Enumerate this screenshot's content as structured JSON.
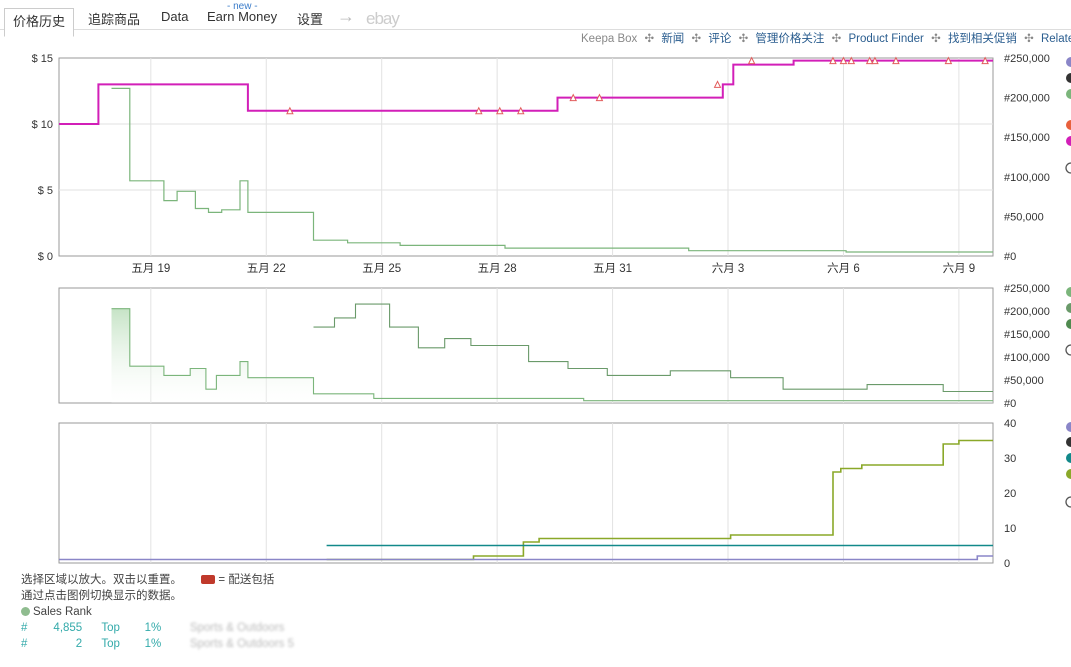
{
  "tabs": {
    "price_history": "价格历史",
    "tracking": "追踪商品",
    "data": "Data",
    "earn": "Earn Money",
    "earn_badge": "- new -",
    "settings": "设置",
    "arrow": "→",
    "ebay": "ebay"
  },
  "links": {
    "keepa_box": "Keepa Box",
    "news": "新闻",
    "reviews": "评论",
    "manage": "管理价格关注",
    "finder": "Product Finder",
    "deals": "找到相关促销",
    "related": "Relate",
    "sep": "✣"
  },
  "colors": {
    "price_line": "#d21fb8",
    "rank_green": "#7bb57b",
    "offer_olive": "#8aa829",
    "offer_teal": "#12898a",
    "offer_purple": "#8a86c8",
    "grid": "#e2e2e2"
  },
  "chart_data": [
    {
      "type": "line",
      "name": "price",
      "x_tick_labels": [
        "五月 19",
        "五月 22",
        "五月 25",
        "五月 28",
        "五月 31",
        "六月 3",
        "六月 6",
        "六月 9"
      ],
      "y_left_ticks": [
        "$ 0",
        "$ 5",
        "$ 10",
        "$ 15"
      ],
      "y_right_ticks": [
        "#0",
        "#50,000",
        "#100,000",
        "#150,000",
        "#200,000",
        "#250,000"
      ],
      "ylim": [
        0,
        15
      ],
      "grid": true,
      "series": [
        {
          "color": "#d21fb8",
          "x": [
            0,
            1.5,
            1.5,
            7.2,
            7.2,
            19,
            19,
            25.3,
            25.3,
            25.7,
            25.7,
            28,
            28,
            35.6
          ],
          "y": [
            10,
            10,
            13,
            13,
            11,
            11,
            12,
            12,
            13,
            13,
            14.5,
            14.5,
            14.8,
            14.8
          ]
        },
        {
          "color": "#7bb57b",
          "x": [
            2,
            2.7,
            2.7,
            4,
            4,
            4.5,
            4.5,
            5.2,
            5.2,
            5.7,
            5.7,
            6.2,
            6.2,
            6.9,
            6.9,
            7.2,
            7.2,
            9.7,
            9.7,
            11,
            11,
            13,
            13,
            17,
            17,
            24,
            24,
            30,
            30,
            35.6
          ],
          "y": [
            12.7,
            12.7,
            5.7,
            5.7,
            4.2,
            4.2,
            4.9,
            4.9,
            3.6,
            3.6,
            3.3,
            3.3,
            3.5,
            3.5,
            5.7,
            5.7,
            3.3,
            3.3,
            1.2,
            1.2,
            1.0,
            1.0,
            0.8,
            0.8,
            0.6,
            0.6,
            0.4,
            0.4,
            0.3,
            0.3
          ]
        }
      ],
      "markers": {
        "x": [
          8.8,
          16,
          16.8,
          17.6,
          19.6,
          20.6,
          25.1,
          26.4,
          29.5,
          29.9,
          30.2,
          30.9,
          31.1,
          31.9,
          33.9,
          35.3
        ],
        "y": [
          11,
          11,
          11,
          11,
          12,
          12,
          13,
          14.8,
          14.8,
          14.8,
          14.8,
          14.8,
          14.8,
          14.8,
          14.8,
          14.8
        ]
      }
    },
    {
      "type": "area",
      "name": "sales-rank",
      "y_right_ticks": [
        "#0",
        "#50,000",
        "#100,000",
        "#150,000",
        "#200,000",
        "#250,000"
      ],
      "ylim": [
        0,
        250000
      ],
      "series": [
        {
          "color": "#7bb57b",
          "x": [
            2,
            2.7,
            2.7,
            4,
            4,
            5,
            5,
            5.6,
            5.6,
            6,
            6,
            6.9,
            6.9,
            7.2,
            7.2,
            9.7,
            9.7,
            12,
            12,
            20,
            20,
            35.6
          ],
          "y": [
            205000,
            205000,
            80000,
            80000,
            60000,
            60000,
            75000,
            75000,
            30000,
            30000,
            60000,
            60000,
            90000,
            90000,
            55000,
            55000,
            20000,
            20000,
            10000,
            10000,
            5000,
            5000
          ]
        },
        {
          "color": "#6a9a6a",
          "x": [
            9.7,
            10.5,
            10.5,
            11.3,
            11.3,
            12.6,
            12.6,
            13.7,
            13.7,
            14.7,
            14.7,
            15.7,
            15.7,
            17.9,
            17.9,
            19.4,
            19.4,
            20.9,
            20.9,
            23.3,
            23.3,
            25.6,
            25.6,
            27.6,
            27.6,
            30.8,
            30.8,
            33.7,
            33.7,
            35.6
          ],
          "y": [
            165000,
            165000,
            185000,
            185000,
            215000,
            215000,
            165000,
            165000,
            120000,
            120000,
            140000,
            140000,
            125000,
            125000,
            90000,
            90000,
            75000,
            75000,
            60000,
            60000,
            70000,
            70000,
            55000,
            55000,
            30000,
            30000,
            40000,
            40000,
            25000,
            25000
          ]
        }
      ]
    },
    {
      "type": "line",
      "name": "offer-count",
      "y_right_ticks": [
        "0",
        "10",
        "20",
        "30",
        "40"
      ],
      "ylim": [
        0,
        40
      ],
      "series": [
        {
          "color": "#8aa829",
          "x": [
            10.2,
            15.8,
            15.8,
            17.7,
            17.7,
            18.3,
            18.3,
            20.1,
            20.1,
            25.6,
            25.6,
            29.5,
            29.5,
            29.8,
            29.8,
            30.6,
            30.6,
            33.7,
            33.7,
            34.3,
            34.3,
            35.6
          ],
          "y": [
            1,
            1,
            2,
            2,
            6,
            6,
            7,
            7,
            7,
            7,
            8,
            8,
            26,
            26,
            27,
            27,
            28,
            28,
            34,
            34,
            35,
            35
          ]
        },
        {
          "color": "#12898a",
          "x": [
            10.2,
            35.6
          ],
          "y": [
            5,
            5
          ]
        },
        {
          "color": "#8a86c8",
          "x": [
            0,
            35,
            35,
            35.6
          ],
          "y": [
            1,
            1,
            2,
            2
          ]
        }
      ]
    }
  ],
  "info": {
    "line1": "选择区域以放大。双击以重置。",
    "truck_text": "= 配送包括",
    "line2": "通过点击图例切换显示的数据。",
    "sales_rank": "Sales Rank"
  },
  "ranks": [
    {
      "hash": "#",
      "value": "4,855",
      "top": "Top",
      "pct": "1%",
      "cat": "Sports & Outdoors"
    },
    {
      "hash": "#",
      "value": "2",
      "top": "Top",
      "pct": "1%",
      "cat": "Sports & Outdoors 5"
    }
  ]
}
